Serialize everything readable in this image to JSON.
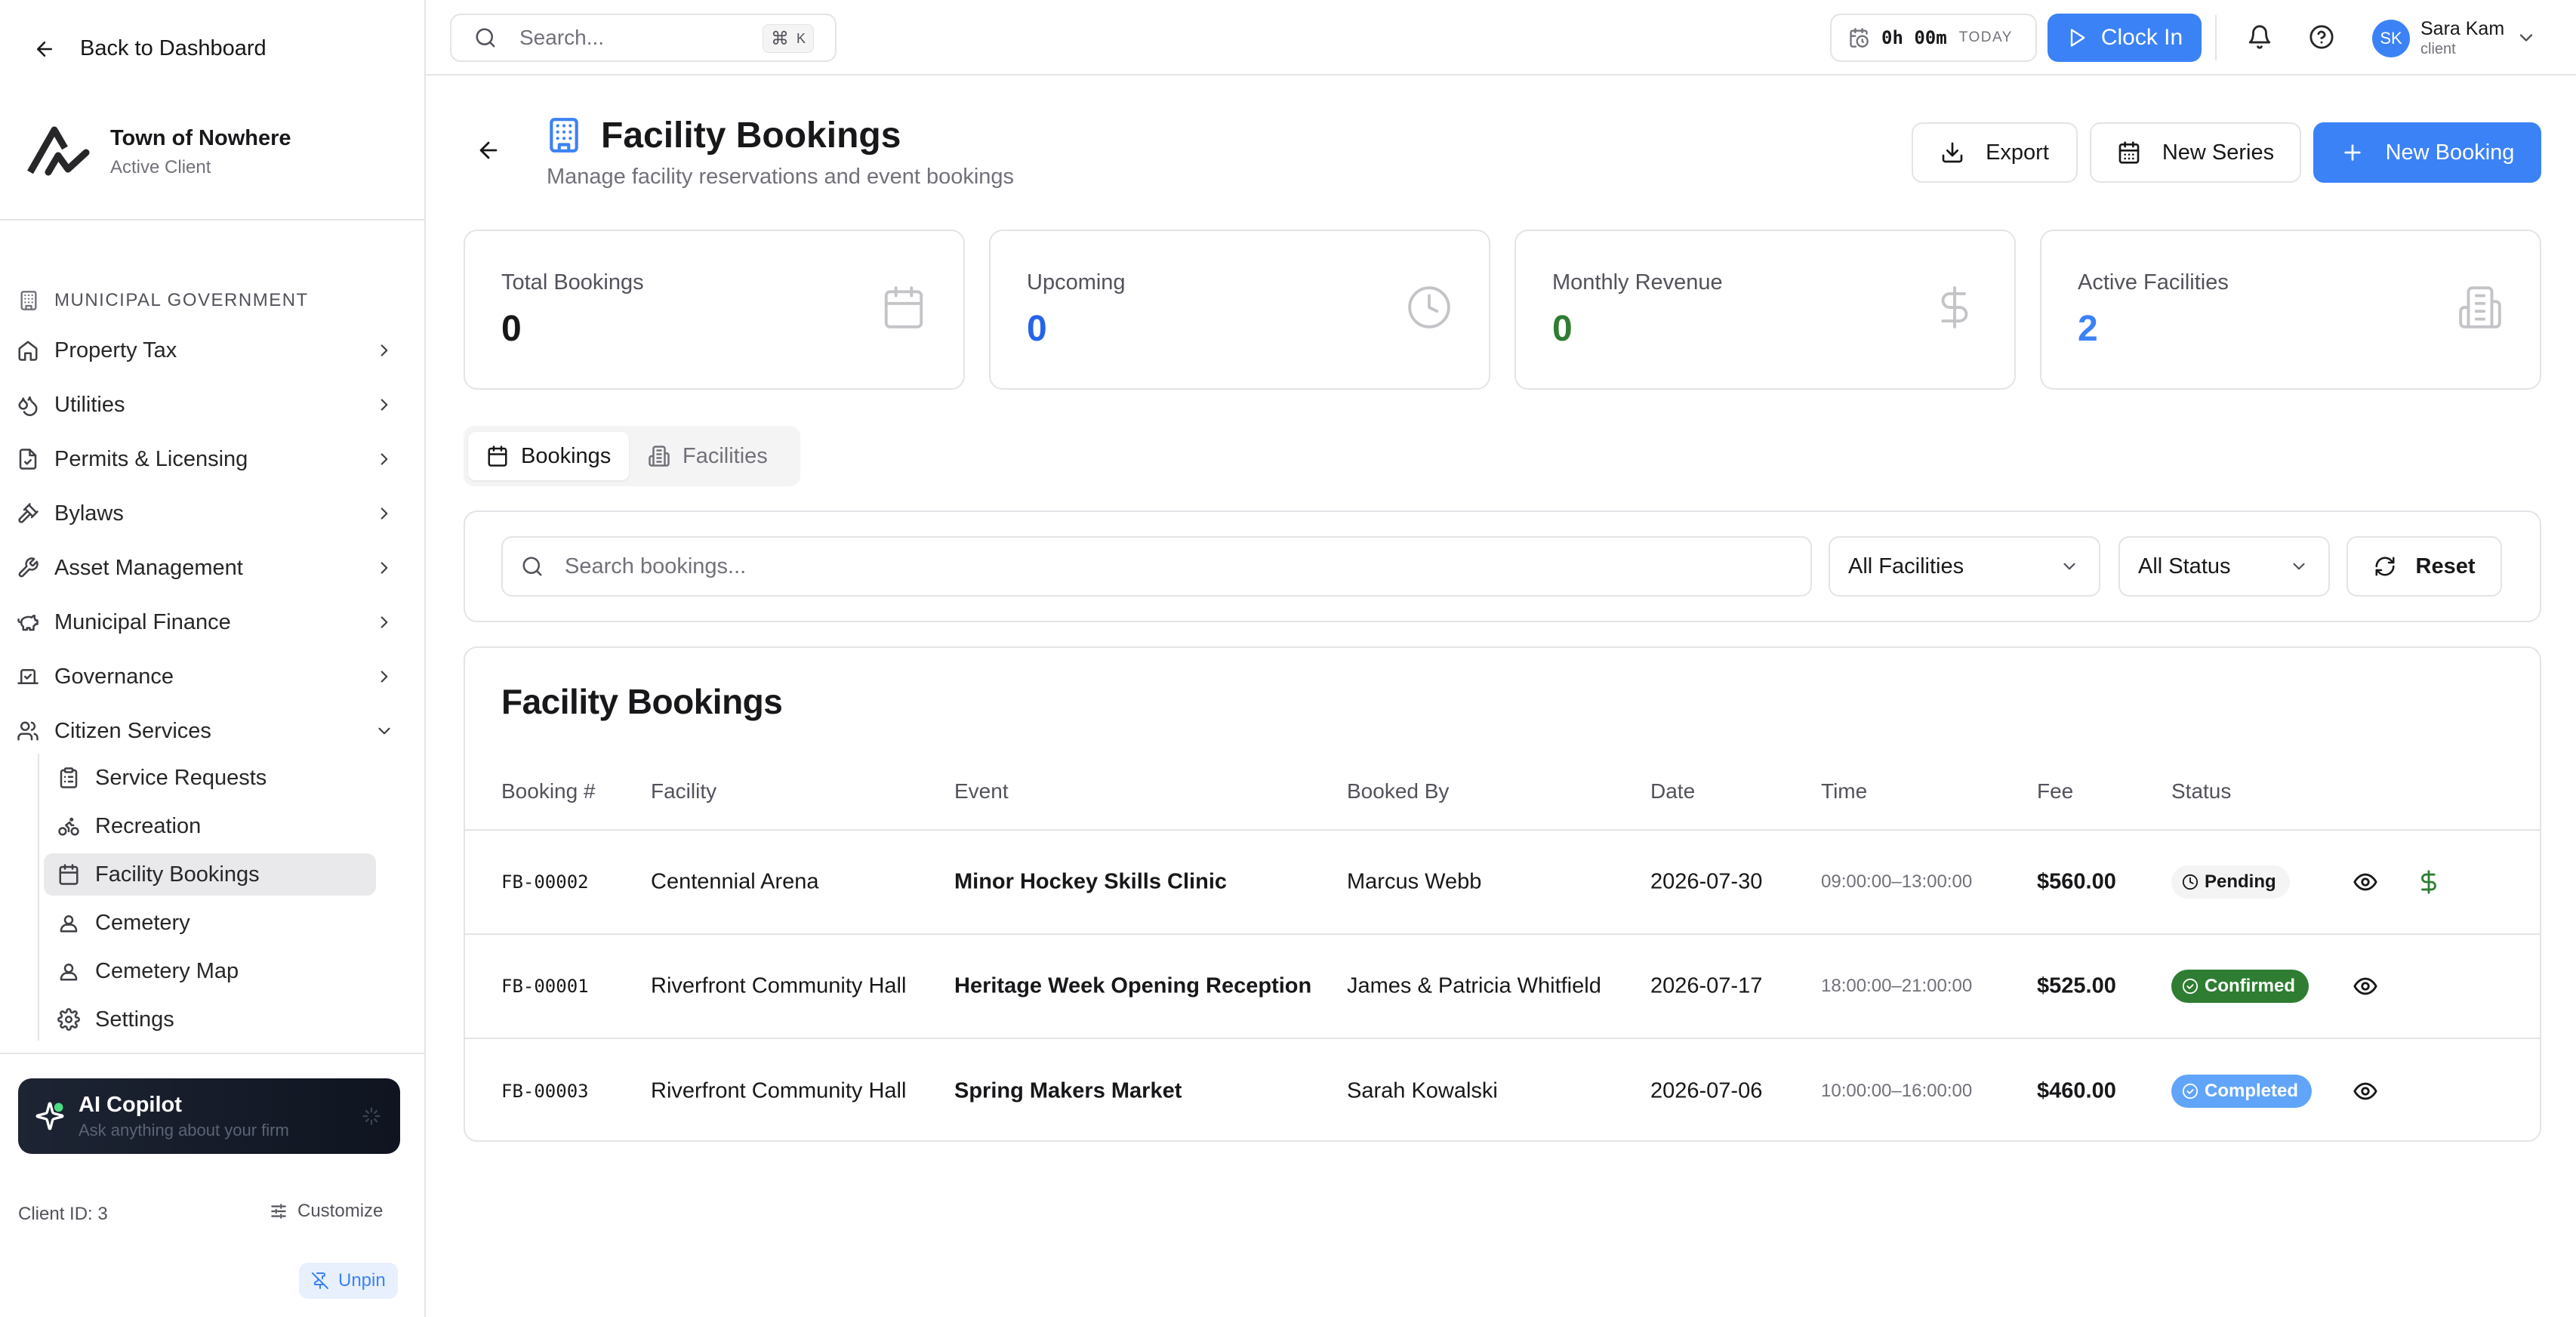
{
  "sidebar": {
    "back_label": "Back to Dashboard",
    "client_name": "Town of Nowhere",
    "client_status": "Active Client",
    "section_label": "MUNICIPAL GOVERNMENT",
    "items": [
      {
        "label": "Property Tax",
        "icon": "home-icon"
      },
      {
        "label": "Utilities",
        "icon": "droplets-icon"
      },
      {
        "label": "Permits & Licensing",
        "icon": "file-check-icon"
      },
      {
        "label": "Bylaws",
        "icon": "gavel-icon"
      },
      {
        "label": "Asset Management",
        "icon": "wrench-icon"
      },
      {
        "label": "Municipal Finance",
        "icon": "piggy-bank-icon"
      },
      {
        "label": "Governance",
        "icon": "vote-icon"
      },
      {
        "label": "Citizen Services",
        "icon": "users-icon"
      }
    ],
    "sub_items": [
      {
        "label": "Service Requests",
        "icon": "clipboard-list-icon"
      },
      {
        "label": "Recreation",
        "icon": "bike-icon"
      },
      {
        "label": "Facility Bookings",
        "icon": "calendar-icon"
      },
      {
        "label": "Cemetery",
        "icon": "user-square-icon"
      },
      {
        "label": "Cemetery Map",
        "icon": "user-square-icon"
      },
      {
        "label": "Settings",
        "icon": "gear-icon"
      }
    ],
    "copilot_title": "AI Copilot",
    "copilot_sub": "Ask anything about your firm",
    "client_id": "Client ID: 3",
    "customize_label": "Customize",
    "unpin_label": "Unpin"
  },
  "topbar": {
    "search_placeholder": "Search...",
    "shortcut_cmd": "⌘",
    "shortcut_key": "K",
    "timer_value": "0h 00m",
    "timer_label": "TODAY",
    "clock_in_label": "Clock In",
    "user_initials": "SK",
    "user_name": "Sara Kam",
    "user_role": "client"
  },
  "page": {
    "title": "Facility Bookings",
    "subtitle": "Manage facility reservations and event bookings",
    "export_label": "Export",
    "new_series_label": "New Series",
    "new_booking_label": "New Booking"
  },
  "stats": [
    {
      "label": "Total Bookings",
      "value": "0",
      "color": "#18181b",
      "icon": "calendar-icon"
    },
    {
      "label": "Upcoming",
      "value": "0",
      "color": "#2563eb",
      "icon": "clock-icon"
    },
    {
      "label": "Monthly Revenue",
      "value": "0",
      "color": "#2e7d32",
      "icon": "dollar-icon"
    },
    {
      "label": "Active Facilities",
      "value": "2",
      "color": "#3b82f6",
      "icon": "building-icon"
    }
  ],
  "tabs": [
    {
      "label": "Bookings",
      "active": true
    },
    {
      "label": "Facilities",
      "active": false
    }
  ],
  "filters": {
    "search_placeholder": "Search bookings...",
    "facility_value": "All Facilities",
    "status_value": "All Status",
    "reset_label": "Reset"
  },
  "table": {
    "title": "Facility Bookings",
    "columns": [
      "Booking #",
      "Facility",
      "Event",
      "Booked By",
      "Date",
      "Time",
      "Fee",
      "Status"
    ],
    "rows": [
      {
        "id": "FB-00002",
        "facility": "Centennial Arena",
        "event": "Minor Hockey Skills Clinic",
        "booked_by": "Marcus Webb",
        "date": "2026-07-30",
        "time": "09:00:00–13:00:00",
        "fee": "$560.00",
        "status": "Pending",
        "status_kind": "pending",
        "has_payment": true
      },
      {
        "id": "FB-00001",
        "facility": "Riverfront Community Hall",
        "event": "Heritage Week Opening Reception",
        "booked_by": "James & Patricia Whitfield",
        "date": "2026-07-17",
        "time": "18:00:00–21:00:00",
        "fee": "$525.00",
        "status": "Confirmed",
        "status_kind": "confirmed",
        "has_payment": false
      },
      {
        "id": "FB-00003",
        "facility": "Riverfront Community Hall",
        "event": "Spring Makers Market",
        "booked_by": "Sarah Kowalski",
        "date": "2026-07-06",
        "time": "10:00:00–16:00:00",
        "fee": "$460.00",
        "status": "Completed",
        "status_kind": "completed",
        "has_payment": false
      }
    ]
  },
  "colors": {
    "accent": "#3b82f6",
    "success": "#2e7d32",
    "border": "#e4e4e7"
  }
}
